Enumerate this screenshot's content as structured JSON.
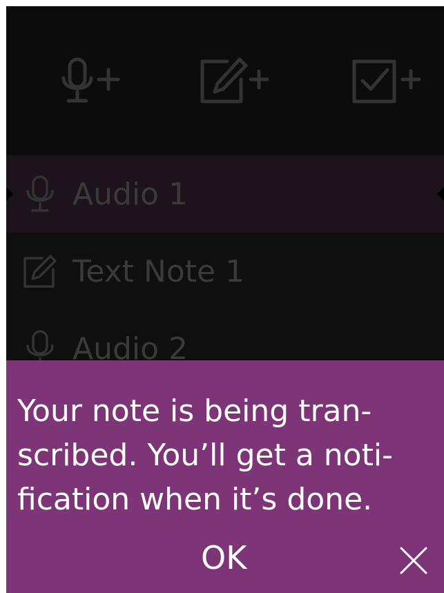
{
  "toolbar": {
    "buttons": [
      {
        "name": "add-audio-button",
        "icon": "microphone-plus-icon"
      },
      {
        "name": "add-text-note-button",
        "icon": "edit-plus-icon"
      },
      {
        "name": "add-checklist-button",
        "icon": "checkbox-plus-icon"
      }
    ]
  },
  "notes": [
    {
      "label": "Audio 1",
      "icon": "microphone-icon",
      "selected": true
    },
    {
      "label": "Text Note 1",
      "icon": "edit-icon",
      "selected": false
    },
    {
      "label": "Audio 2",
      "icon": "microphone-icon",
      "selected": false
    }
  ],
  "dialog": {
    "message_lines": [
      "Your note is being tran-",
      "scribed. You’ll get a noti-",
      "fication when it’s done."
    ],
    "ok_label": "OK",
    "close_icon": "close-icon"
  },
  "colors": {
    "background": "#0e0f0e",
    "toolbar_icon": "#333333",
    "selected_row": "#1d131c",
    "dialog_background": "#7d3577",
    "dialog_text": "#ffffff"
  }
}
